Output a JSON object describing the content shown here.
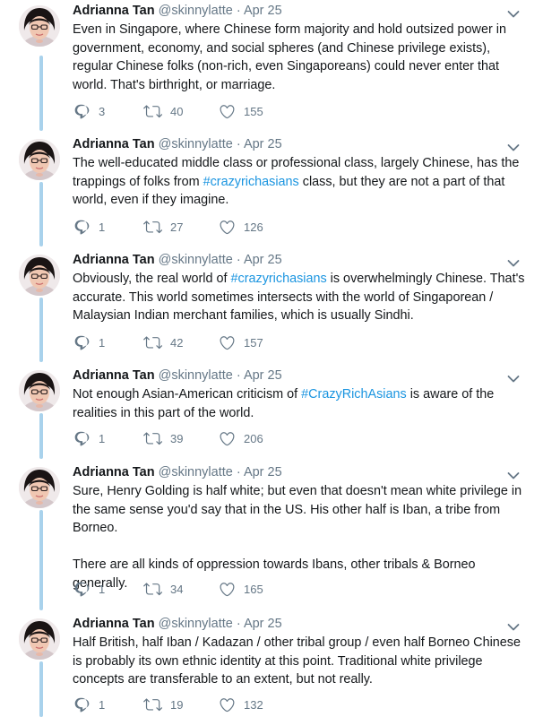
{
  "author": {
    "name": "Adrianna Tan",
    "handle": "@skinnylatte",
    "date": "Apr 25"
  },
  "colors": {
    "thread_line": "#a9d2ec",
    "hashtag": "#1b95e0",
    "meta_text": "#657786"
  },
  "tweets": [
    {
      "segments": [
        {
          "text": "Even in Singapore, where Chinese form majority and hold outsized power in government, economy, and social spheres (and Chinese privilege exists), regular Chinese folks (non-rich, even Singaporeans) could never enter that world. That's birthright, or marriage."
        }
      ],
      "replies": "3",
      "retweets": "40",
      "likes": "155"
    },
    {
      "segments": [
        {
          "text": "The well-educated middle class or professional class, largely Chinese, has the trappings of folks from "
        },
        {
          "hashtag": "#crazyrichasians"
        },
        {
          "text": " class, but they are not a part of that world, even if they imagine."
        }
      ],
      "replies": "1",
      "retweets": "27",
      "likes": "126"
    },
    {
      "segments": [
        {
          "text": "Obviously, the real world of "
        },
        {
          "hashtag": "#crazyrichasians"
        },
        {
          "text": " is overwhelmingly Chinese. That's accurate. This world sometimes intersects with the world of Singaporean / Malaysian Indian merchant families, which is usually Sindhi."
        }
      ],
      "replies": "1",
      "retweets": "42",
      "likes": "157"
    },
    {
      "segments": [
        {
          "text": "Not enough Asian-American criticism of "
        },
        {
          "hashtag": "#CrazyRichAsians"
        },
        {
          "text": " is aware of the realities in this part of the world."
        }
      ],
      "replies": "1",
      "retweets": "39",
      "likes": "206"
    },
    {
      "segments": [
        {
          "text": "Sure, Henry Golding is half white; but even that doesn't mean white privilege in the same sense you'd say that in the US. His other half is Iban, a tribe from Borneo."
        }
      ],
      "paragraph2": "There are all kinds of oppression towards Ibans, other tribals & Borneo generally.",
      "replies": "1",
      "retweets": "34",
      "likes": "165"
    },
    {
      "segments": [
        {
          "text": "Half British, half Iban / Kadazan / other tribal group / even half Borneo Chinese is probably its own ethnic identity at this point. Traditional white privilege concepts are transferable to an extent, but not really."
        }
      ],
      "replies": "1",
      "retweets": "19",
      "likes": "132"
    }
  ]
}
